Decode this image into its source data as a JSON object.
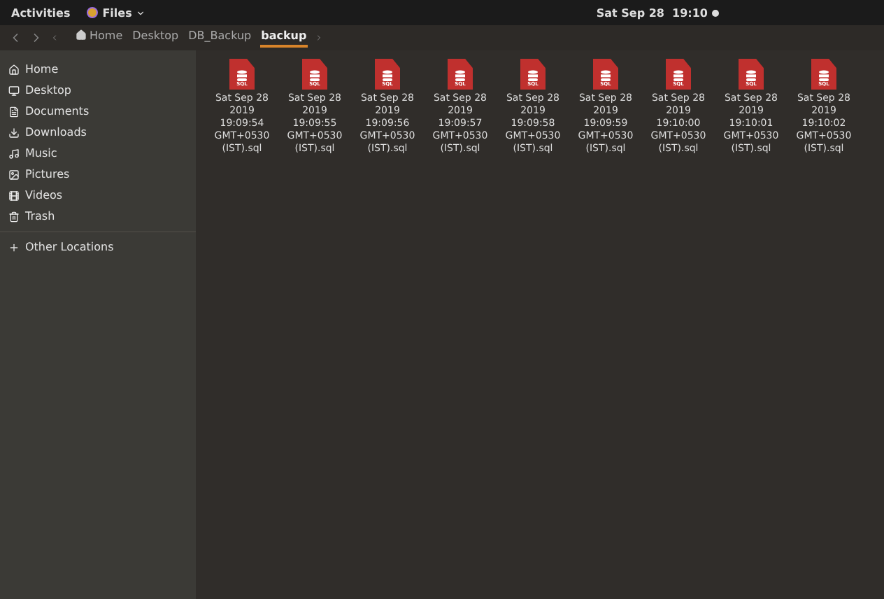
{
  "top_bar": {
    "activities": "Activities",
    "app_menu": "Files",
    "clock": "Sat Sep 28  19:10"
  },
  "path_bar": [
    {
      "label": "Home",
      "selected": false,
      "kind": "home"
    },
    {
      "label": "Desktop",
      "selected": false,
      "kind": "plain"
    },
    {
      "label": "DB_Backup",
      "selected": false,
      "kind": "plain"
    },
    {
      "label": "backup",
      "selected": true,
      "kind": "plain"
    }
  ],
  "sidebar": {
    "items": [
      {
        "label": "Home",
        "kind": "home"
      },
      {
        "label": "Desktop",
        "kind": "desktop"
      },
      {
        "label": "Documents",
        "kind": "documents"
      },
      {
        "label": "Downloads",
        "kind": "downloads"
      },
      {
        "label": "Music",
        "kind": "music"
      },
      {
        "label": "Pictures",
        "kind": "pictures"
      },
      {
        "label": "Videos",
        "kind": "videos"
      },
      {
        "label": "Trash",
        "kind": "trash"
      }
    ],
    "other": "Other Locations"
  },
  "files": [
    {
      "badge": "SQL",
      "name": "Sat Sep 28 2019 19:09:54 GMT+0530 (IST).sql"
    },
    {
      "badge": "SQL",
      "name": "Sat Sep 28 2019 19:09:55 GMT+0530 (IST).sql"
    },
    {
      "badge": "SQL",
      "name": "Sat Sep 28 2019 19:09:56 GMT+0530 (IST).sql"
    },
    {
      "badge": "SQL",
      "name": "Sat Sep 28 2019 19:09:57 GMT+0530 (IST).sql"
    },
    {
      "badge": "SQL",
      "name": "Sat Sep 28 2019 19:09:58 GMT+0530 (IST).sql"
    },
    {
      "badge": "SQL",
      "name": "Sat Sep 28 2019 19:09:59 GMT+0530 (IST).sql"
    },
    {
      "badge": "SQL",
      "name": "Sat Sep 28 2019 19:10:00 GMT+0530 (IST).sql"
    },
    {
      "badge": "SQL",
      "name": "Sat Sep 28 2019 19:10:01 GMT+0530 (IST).sql"
    },
    {
      "badge": "SQL",
      "name": "Sat Sep 28 2019 19:10:02 GMT+0530 (IST).sql"
    }
  ]
}
